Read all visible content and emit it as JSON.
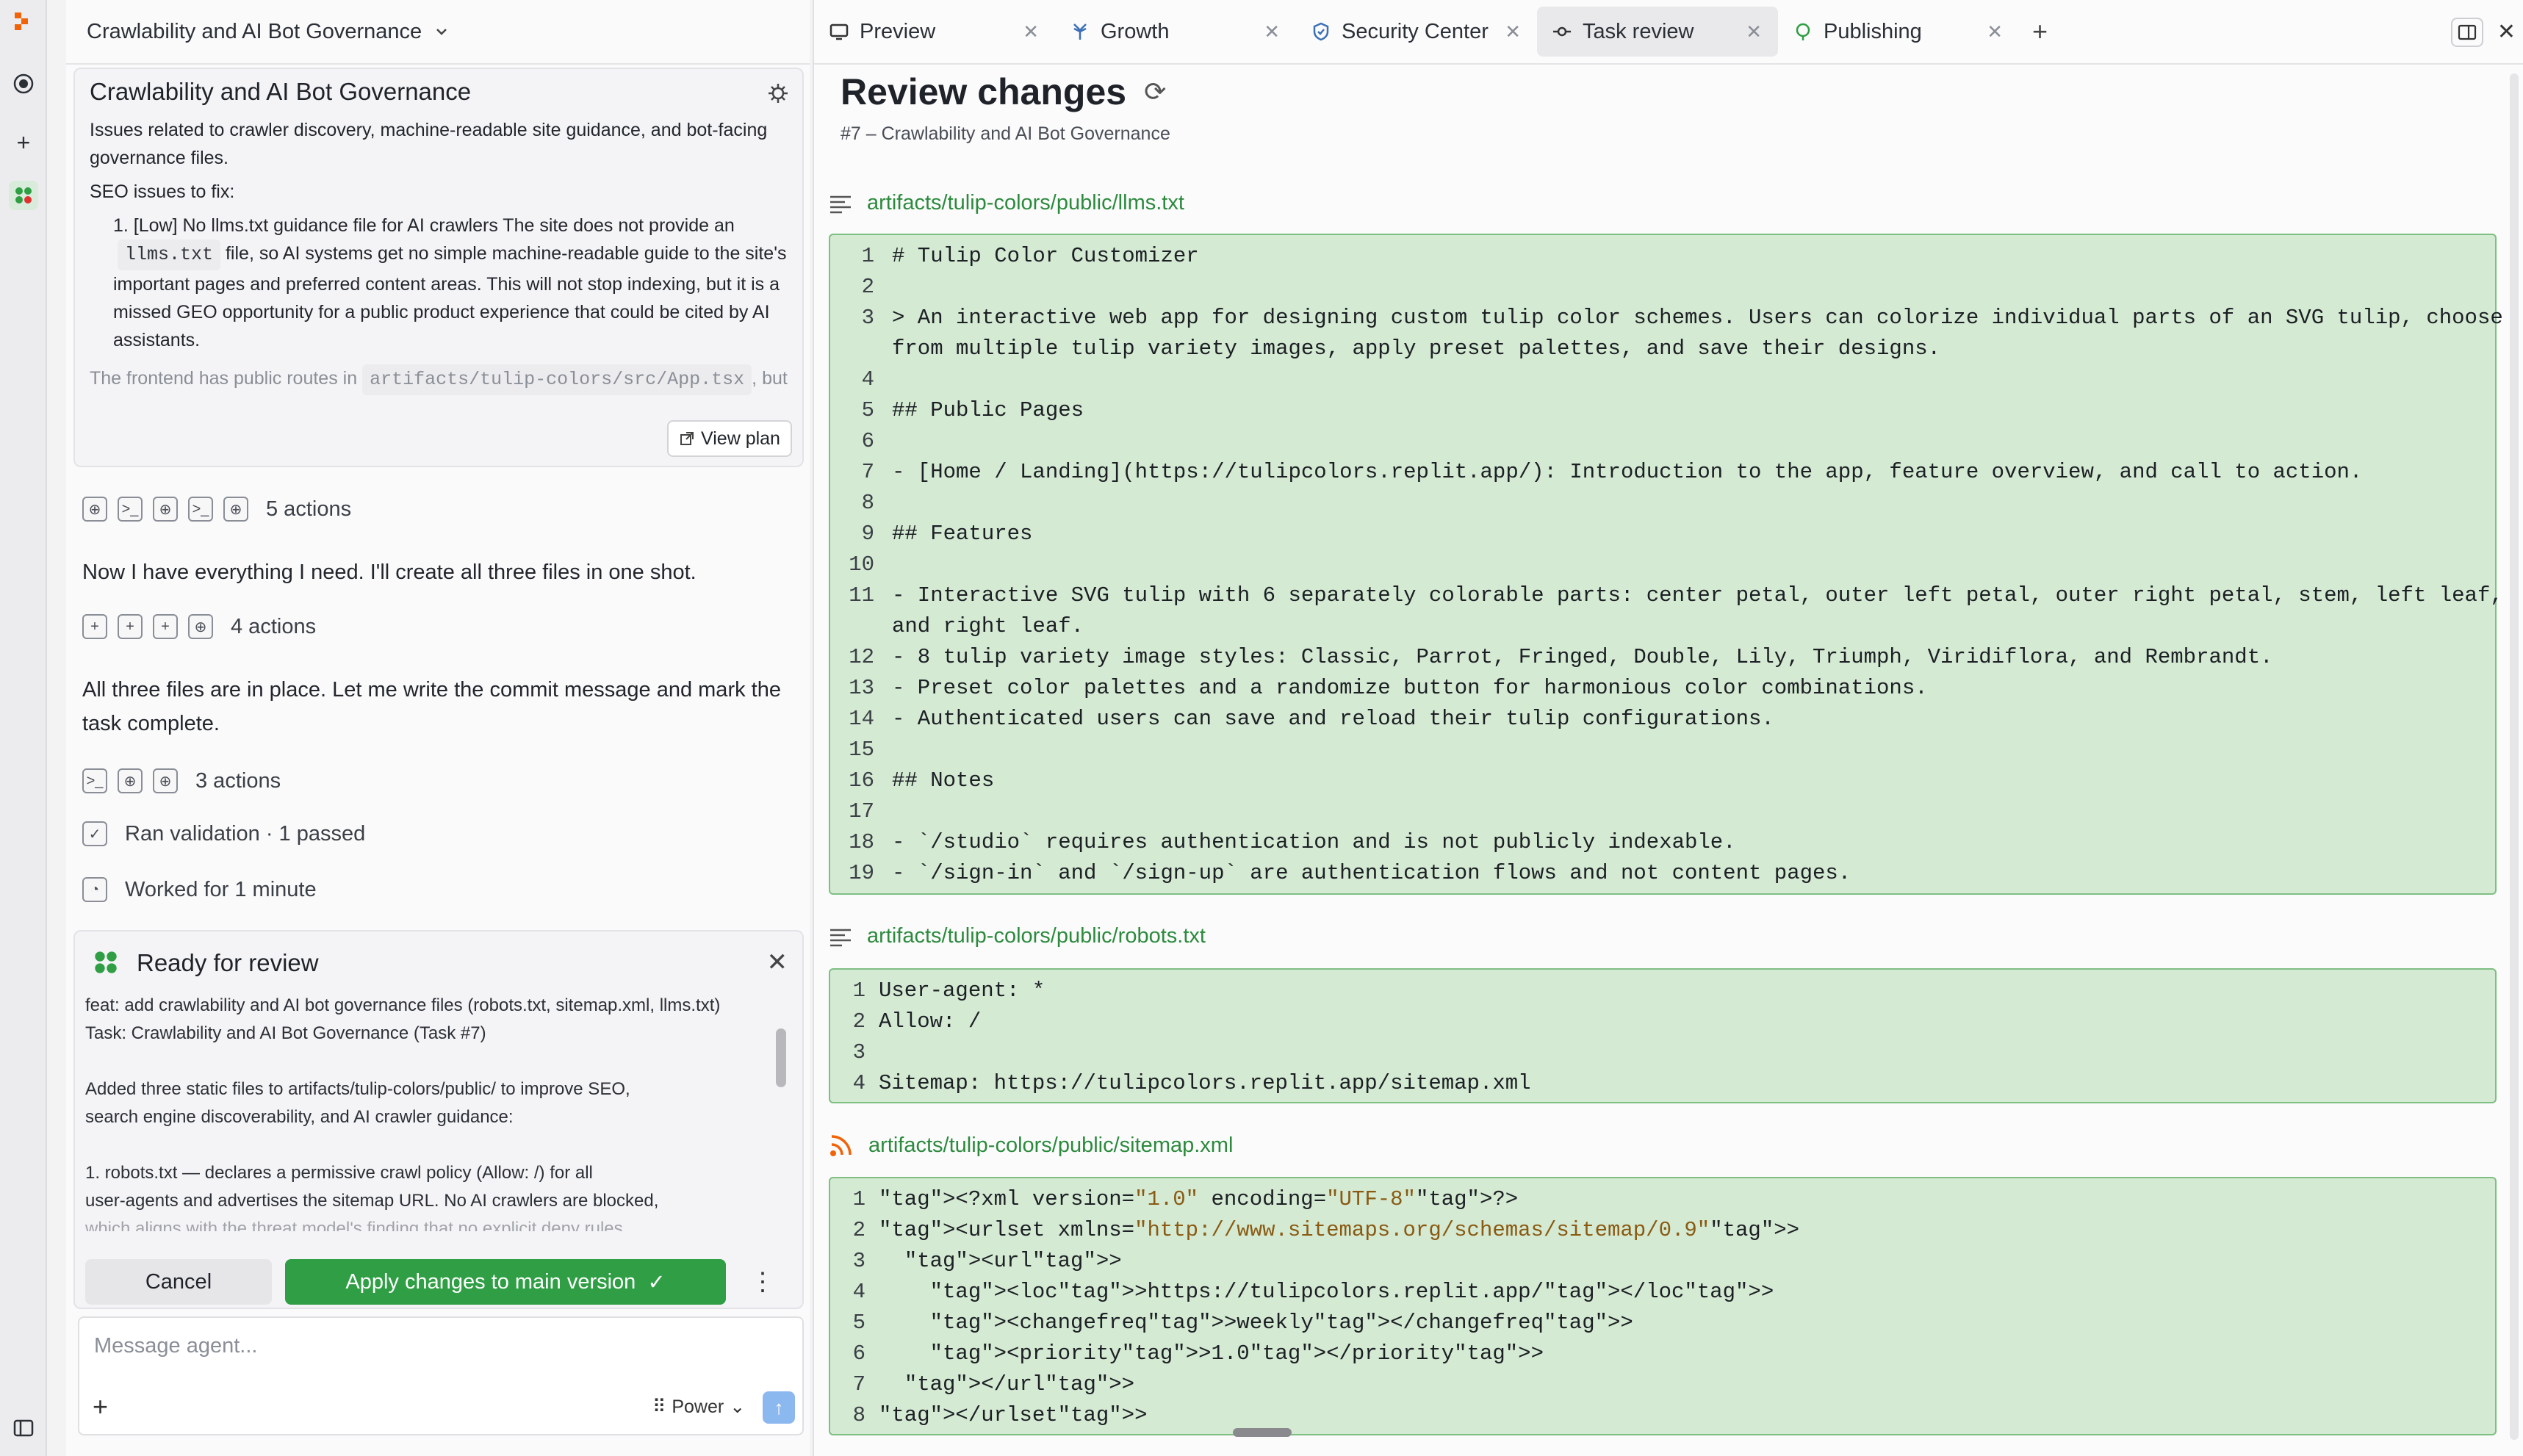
{
  "left": {
    "header_title": "Crawlability and AI Bot Governance",
    "task_card": {
      "title": "Crawlability and AI Bot Governance",
      "desc_line1": "Issues related to crawler discovery, machine-readable site guidance, and bot-facing",
      "desc_line2": "governance files.",
      "seo_label": "SEO issues to fix:",
      "item_line1": "1. [Low] No llms.txt guidance file for AI crawlers The site does not provide an",
      "item_chip": "llms.txt",
      "item_line2_rest": "file, so AI systems get no simple machine-readable guide to the site's",
      "item_line3": "important pages and preferred content areas. This will not stop indexing, but it is a",
      "item_line4": "missed GEO opportunity for a public product experience that could be cited by AI",
      "item_line5": "assistants.",
      "faded_prefix": "The frontend has public routes in",
      "faded_chip": "artifacts/tulip-colors/src/App.tsx",
      "faded_suffix": ", but",
      "view_plan": "View plan"
    },
    "actions1": "5 actions",
    "msg1": "Now I have everything I need. I'll create all three files in one shot.",
    "actions2": "4 actions",
    "msg2_line1": "All three files are in place. Let me write the commit message and mark the",
    "msg2_line2": "task complete.",
    "actions3": "3 actions",
    "validation": "Ran validation · 1 passed",
    "worked": "Worked for 1 minute",
    "review": {
      "title": "Ready for review",
      "commit": "feat: add crawlability and AI bot governance files (robots.txt, sitemap.xml, llms.txt)",
      "task": "Task: Crawlability and AI Bot Governance (Task #7)",
      "body1": "Added three static files to artifacts/tulip-colors/public/ to improve SEO,",
      "body2": "search engine discoverability, and AI crawler guidance:",
      "body3": "1. robots.txt — declares a permissive crawl policy (Allow: /) for all",
      "body4": "user-agents and advertises the sitemap URL. No AI crawlers are blocked,",
      "body5": "which aligns with the threat model's finding that no explicit deny rules",
      "cancel": "Cancel",
      "apply": "Apply changes to main version"
    },
    "composer": {
      "placeholder": "Message agent...",
      "mode": "Power"
    }
  },
  "tabs": [
    {
      "label": "Preview",
      "icon": "monitor-icon"
    },
    {
      "label": "Growth",
      "icon": "growth-icon"
    },
    {
      "label": "Security Center",
      "icon": "shield-icon"
    },
    {
      "label": "Task review",
      "icon": "commit-icon"
    },
    {
      "label": "Publishing",
      "icon": "publish-icon"
    }
  ],
  "review_panel": {
    "title": "Review changes",
    "subtitle": "#7 – Crawlability and AI Bot Governance",
    "files": [
      {
        "path": "artifacts/tulip-colors/public/llms.txt",
        "lines": [
          "# Tulip Color Customizer",
          "",
          "> An interactive web app for designing custom tulip color schemes. Users can colorize individual parts of an SVG tulip, choose",
          "from multiple tulip variety images, apply preset palettes, and save their designs.",
          "",
          "## Public Pages",
          "",
          "- [Home / Landing](https://tulipcolors.replit.app/): Introduction to the app, feature overview, and call to action.",
          "",
          "## Features",
          "",
          "- Interactive SVG tulip with 6 separately colorable parts: center petal, outer left petal, outer right petal, stem, left leaf,",
          "and right leaf.",
          "- 8 tulip variety image styles: Classic, Parrot, Fringed, Double, Lily, Triumph, Viridiflora, and Rembrandt.",
          "- Preset color palettes and a randomize button for harmonious color combinations.",
          "- Authenticated users can save and reload their tulip configurations.",
          "",
          "## Notes",
          "",
          "- `/studio` requires authentication and is not publicly indexable.",
          "- `/sign-in` and `/sign-up` are authentication flows and not content pages."
        ],
        "numbers": [
          "1",
          "2",
          "3",
          "",
          "4",
          "5",
          "6",
          "7",
          "8",
          "9",
          "10",
          "11",
          "",
          "12",
          "13",
          "14",
          "15",
          "16",
          "17",
          "18",
          "19"
        ]
      },
      {
        "path": "artifacts/tulip-colors/public/robots.txt",
        "lines": [
          "User-agent: *",
          "Allow: /",
          "",
          "Sitemap: https://tulipcolors.replit.app/sitemap.xml"
        ],
        "numbers": [
          "1",
          "2",
          "3",
          "4"
        ]
      },
      {
        "path": "artifacts/tulip-colors/public/sitemap.xml",
        "lines": [
          "<?xml version=\"1.0\" encoding=\"UTF-8\"?>",
          "<urlset xmlns=\"http://www.sitemaps.org/schemas/sitemap/0.9\">",
          "  <url>",
          "    <loc>https://tulipcolors.replit.app/</loc>",
          "    <changefreq>weekly</changefreq>",
          "    <priority>1.0</priority>",
          "  </url>",
          "</urlset>"
        ],
        "numbers": [
          "1",
          "2",
          "3",
          "4",
          "5",
          "6",
          "7",
          "8"
        ]
      }
    ]
  },
  "colors": {
    "accent_green": "#2f9e44",
    "diff_bg": "#d4ead3",
    "diff_border": "#7fbf83"
  }
}
